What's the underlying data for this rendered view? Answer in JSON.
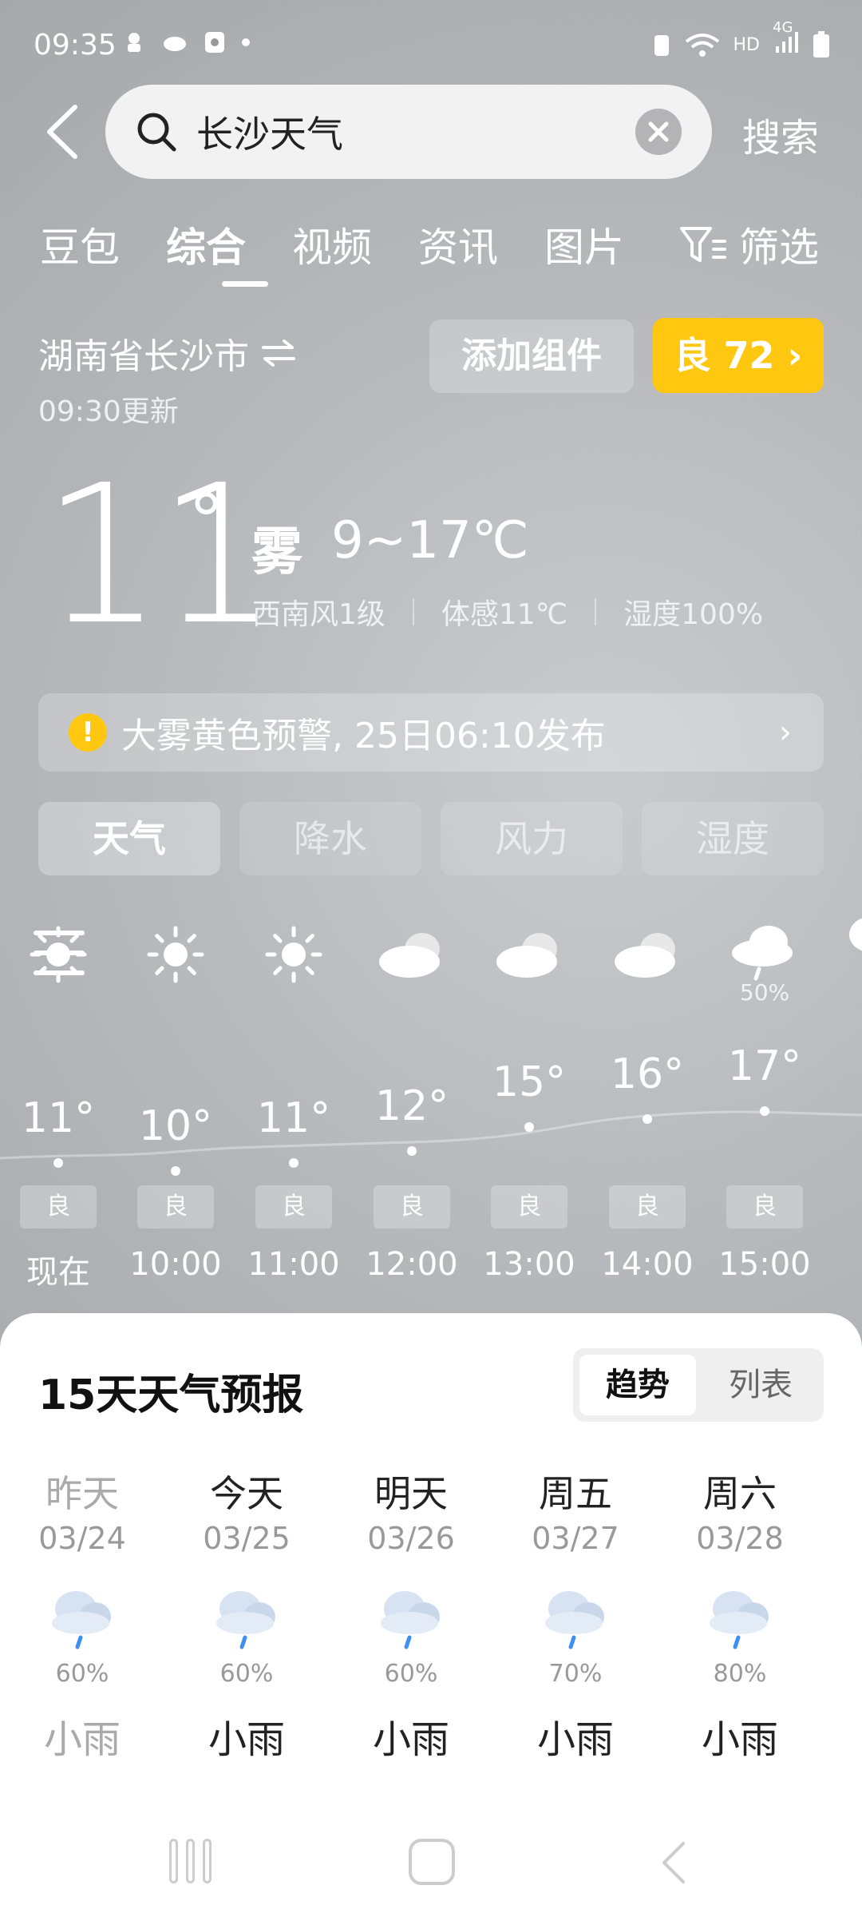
{
  "status": {
    "time": "09:35",
    "network": "HD",
    "signal": "4G"
  },
  "search": {
    "query": "长沙天气",
    "submit_label": "搜索"
  },
  "tabs": [
    "豆包",
    "综合",
    "视频",
    "资讯",
    "图片",
    "筛选"
  ],
  "location": {
    "name": "湖南省长沙市",
    "updated": "09:30更新"
  },
  "buttons": {
    "add_widget": "添加组件",
    "aqi": "良 72 ›"
  },
  "current": {
    "temp": "11",
    "deg": "°",
    "condition": "雾",
    "range": "9~17℃",
    "wind": "西南风1级",
    "feels": "体感11℃",
    "humidity": "湿度100%"
  },
  "warning": {
    "text": "大雾黄色预警, 25日06:10发布"
  },
  "metric_tabs": [
    "天气",
    "降水",
    "风力",
    "湿度"
  ],
  "hourly": [
    {
      "time": "现在",
      "temp": "11°",
      "aq": "良",
      "icon": "sun-icon",
      "pop": ""
    },
    {
      "time": "10:00",
      "temp": "10°",
      "aq": "良",
      "icon": "sun-icon",
      "pop": ""
    },
    {
      "time": "11:00",
      "temp": "11°",
      "aq": "良",
      "icon": "sun-icon",
      "pop": ""
    },
    {
      "time": "12:00",
      "temp": "12°",
      "aq": "良",
      "icon": "cloud-icon",
      "pop": ""
    },
    {
      "time": "13:00",
      "temp": "15°",
      "aq": "良",
      "icon": "cloud-icon",
      "pop": ""
    },
    {
      "time": "14:00",
      "temp": "16°",
      "aq": "良",
      "icon": "cloud-icon",
      "pop": ""
    },
    {
      "time": "15:00",
      "temp": "17°",
      "aq": "良",
      "icon": "rain-cloud-icon",
      "pop": "50%"
    }
  ],
  "forecast": {
    "title": "15天天气预报",
    "toggle": {
      "active": "趋势",
      "other": "列表"
    },
    "days": [
      {
        "name": "昨天",
        "date": "03/24",
        "pop": "60%",
        "cond": "小雨"
      },
      {
        "name": "今天",
        "date": "03/25",
        "pop": "60%",
        "cond": "小雨"
      },
      {
        "name": "明天",
        "date": "03/26",
        "pop": "60%",
        "cond": "小雨"
      },
      {
        "name": "周五",
        "date": "03/27",
        "pop": "70%",
        "cond": "小雨"
      },
      {
        "name": "周六",
        "date": "03/28",
        "pop": "80%",
        "cond": "小雨"
      }
    ]
  },
  "colors": {
    "accent_yellow": "#ffc70f",
    "rain_blue": "#3d8ef5"
  }
}
